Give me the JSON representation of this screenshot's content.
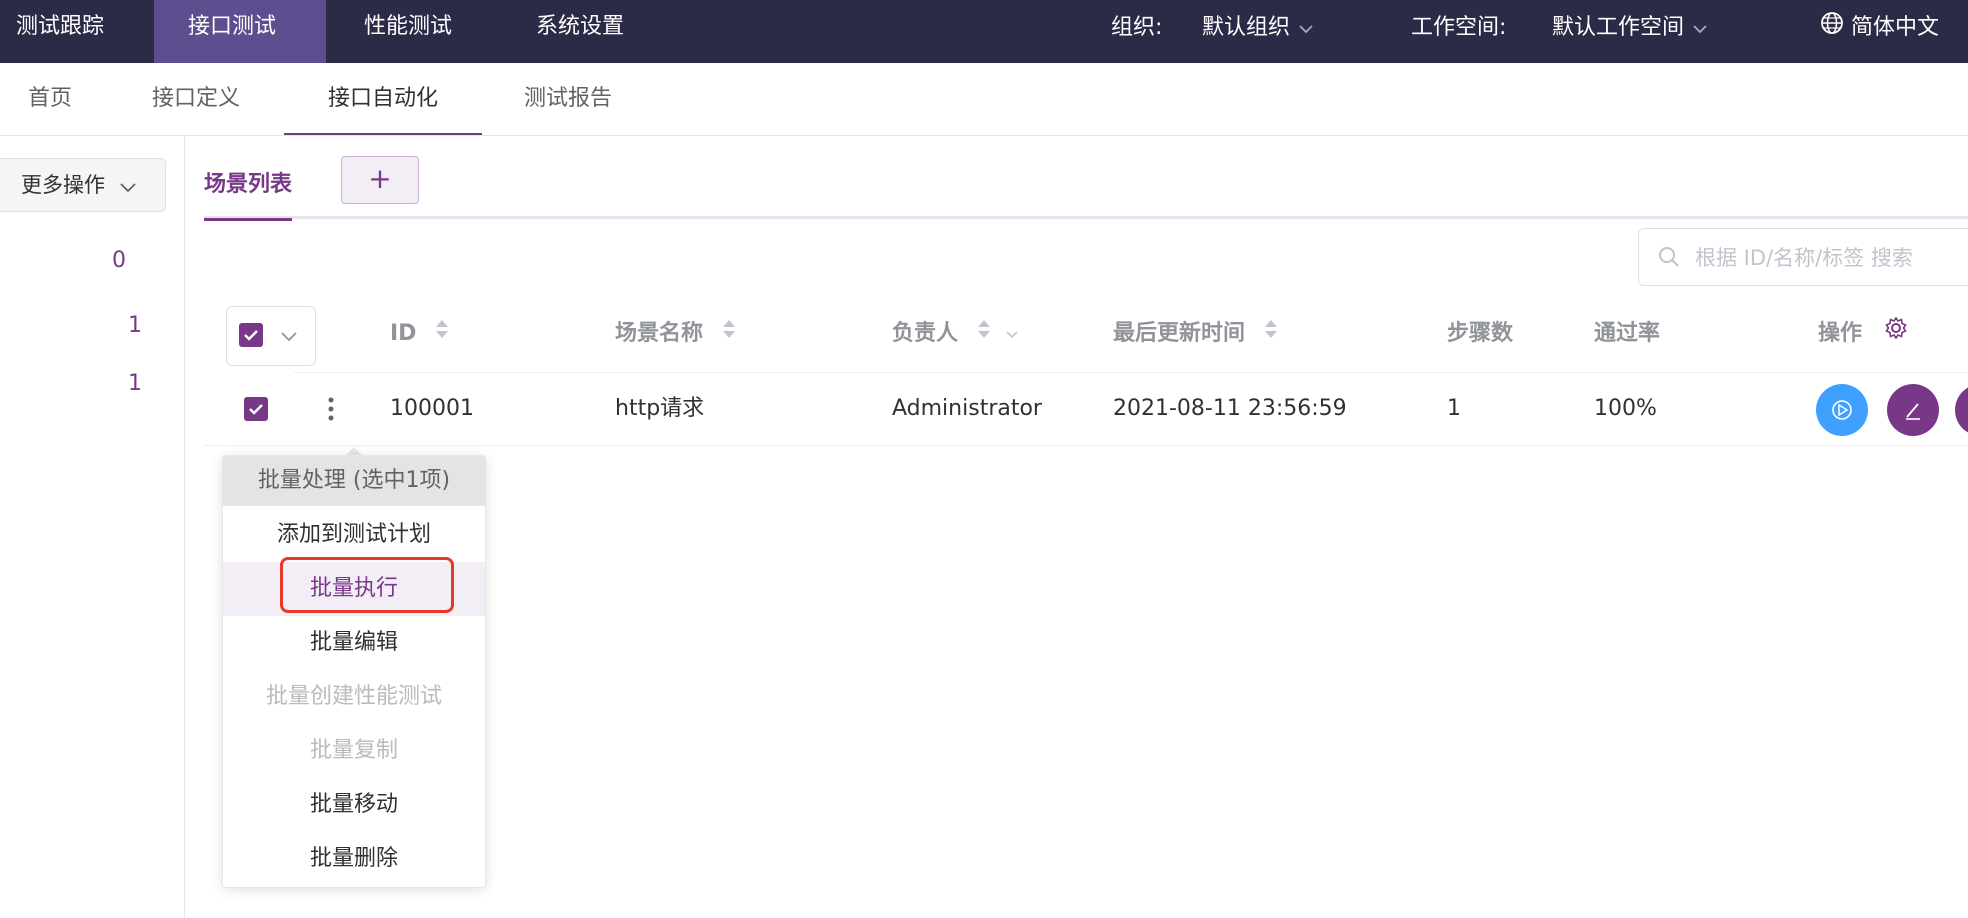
{
  "top_nav": {
    "items": [
      "测试跟踪",
      "接口测试",
      "性能测试",
      "系统设置"
    ],
    "org_label": "组织:",
    "org_value": "默认组织",
    "workspace_label": "工作空间:",
    "workspace_value": "默认工作空间",
    "language": "简体中文"
  },
  "sub_nav": {
    "items": [
      "首页",
      "接口定义",
      "接口自动化",
      "测试报告"
    ]
  },
  "left_panel": {
    "more_actions": "更多操作",
    "counts": [
      "0",
      "1",
      "1"
    ]
  },
  "tabs": {
    "scene_list": "场景列表",
    "add": "+"
  },
  "search": {
    "placeholder": "根据 ID/名称/标签 搜索"
  },
  "table": {
    "headers": {
      "id": "ID",
      "name": "场景名称",
      "owner": "负责人",
      "updated": "最后更新时间",
      "steps": "步骤数",
      "pass_rate": "通过率",
      "ops": "操作"
    },
    "rows": [
      {
        "id": "100001",
        "name": "http请求",
        "owner": "Administrator",
        "updated": "2021-08-11 23:56:59",
        "steps": "1",
        "pass_rate": "100%"
      }
    ]
  },
  "batch_menu": {
    "header": "批量处理 (选中1项)",
    "items": [
      "添加到测试计划",
      "批量执行",
      "批量编辑",
      "批量创建性能测试",
      "批量复制",
      "批量移动",
      "批量删除"
    ]
  },
  "colors": {
    "primary": "#783887",
    "topbar": "#2b2a47",
    "run_button": "#3fa0ff",
    "highlight": "#e53a2a"
  }
}
